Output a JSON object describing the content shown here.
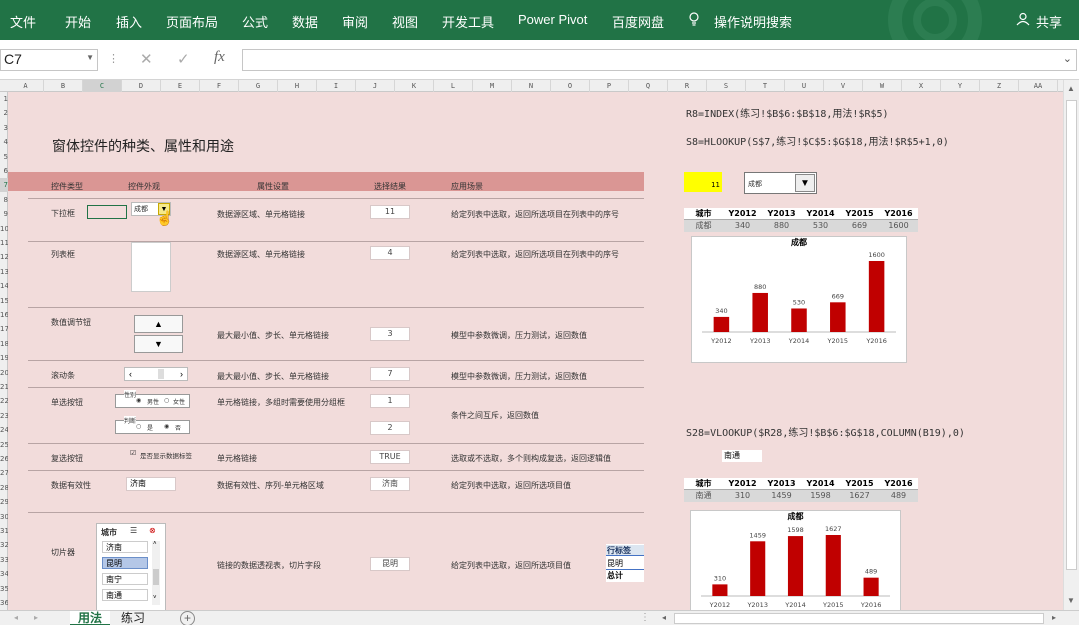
{
  "ribbon": {
    "tabs": [
      "文件",
      "开始",
      "插入",
      "页面布局",
      "公式",
      "数据",
      "审阅",
      "视图",
      "开发工具",
      "Power Pivot",
      "百度网盘"
    ],
    "tell_me": "操作说明搜索",
    "share": "共享"
  },
  "formula_bar": {
    "name_box": "C7",
    "cancel": "✕",
    "enter": "✓",
    "fx": "fx",
    "formula": ""
  },
  "columns": [
    "A",
    "B",
    "C",
    "D",
    "E",
    "F",
    "G",
    "H",
    "I",
    "J",
    "K",
    "L",
    "M",
    "N",
    "O",
    "P",
    "Q",
    "R",
    "S",
    "T",
    "U",
    "V",
    "W",
    "X",
    "Y",
    "Z",
    "AA"
  ],
  "rows": [
    "1",
    "2",
    "3",
    "4",
    "5",
    "6",
    "7",
    "8",
    "9",
    "10",
    "11",
    "12",
    "13",
    "14",
    "15",
    "16",
    "17",
    "18",
    "19",
    "20",
    "21",
    "22",
    "23",
    "24",
    "25",
    "26",
    "27",
    "28",
    "29",
    "30",
    "31",
    "32",
    "33",
    "34",
    "35",
    "36"
  ],
  "sheet": {
    "title": "窗体控件的种类、属性和用途",
    "header": {
      "type": "控件类型",
      "look": "控件外观",
      "attr": "属性设置",
      "result": "选择结果",
      "scene": "应用场景"
    },
    "rows": [
      {
        "type": "下拉框",
        "attr": "数据源区域、单元格链接",
        "result": "11",
        "scene": "给定列表中选取，返回所选项目在列表中的序号"
      },
      {
        "type": "列表框",
        "attr": "数据源区域、单元格链接",
        "result": "4",
        "scene": "给定列表中选取，返回所选项目在列表中的序号"
      },
      {
        "type": "数值调节钮",
        "attr": "最大最小值、步长、单元格链接",
        "result": "3",
        "scene": "模型中参数微调，压力测试，返回数值"
      },
      {
        "type": "滚动条",
        "attr": "最大最小值、步长、单元格链接",
        "result": "7",
        "scene": "模型中参数微调，压力测试，返回数值"
      },
      {
        "type": "单选按钮",
        "attr": "单元格链接，多组时需要使用分组框",
        "result": "1",
        "result2": "2",
        "scene": "条件之间互斥，返回数值"
      },
      {
        "type": "复选按钮",
        "attr": "单元格链接",
        "result": "TRUE",
        "scene": "选取或不选取，多个则构成复选，返回逻辑值"
      },
      {
        "type": "数据有效性",
        "attr": "数据有效性、序列-单元格区域",
        "result": "济南",
        "scene": "给定列表中选取，返回所选项目值"
      },
      {
        "type": "切片器",
        "attr": "链接的数据透视表，切片字段",
        "result": "昆明",
        "scene": "给定列表中选取，返回所选项目值"
      }
    ],
    "dropdown_value": "成都",
    "groupbox1_title": "性别",
    "radio_male": "男性",
    "radio_female": "女性",
    "groupbox2_title": "判断",
    "radio_yes": "是",
    "radio_no": "否",
    "checkbox_label": "是否显示数据标签",
    "validation_value": "济南",
    "slicer": {
      "title": "城市",
      "items": [
        "济南",
        "昆明",
        "南宁",
        "南通"
      ],
      "selected": "昆明"
    },
    "pivot": {
      "header": "行标签",
      "item": "昆明",
      "total": "总计"
    }
  },
  "right": {
    "formula1": "R8=INDEX(练习!$B$6:$B$18,用法!$R$5)",
    "formula2": "S8=HLOOKUP(S$7,练习!$C$5:$G$18,用法!$R$5+1,0)",
    "yellow_value": "11",
    "combo_value": "成都",
    "formula3": "S28=VLOOKUP($R28,练习!$B$6:$G$18,COLUMN(B19),0)",
    "validation_cell": "南通"
  },
  "table1": {
    "headers": [
      "城市",
      "Y2012",
      "Y2013",
      "Y2014",
      "Y2015",
      "Y2016"
    ],
    "row": [
      "成都",
      "340",
      "880",
      "530",
      "669",
      "1600"
    ]
  },
  "table2": {
    "headers": [
      "城市",
      "Y2012",
      "Y2013",
      "Y2014",
      "Y2015",
      "Y2016"
    ],
    "row": [
      "南通",
      "310",
      "1459",
      "1598",
      "1627",
      "489"
    ]
  },
  "chart_data": [
    {
      "type": "bar",
      "title": "成都",
      "categories": [
        "Y2012",
        "Y2013",
        "Y2014",
        "Y2015",
        "Y2016"
      ],
      "values": [
        340,
        880,
        530,
        669,
        1600
      ],
      "color": "#c00000"
    },
    {
      "type": "bar",
      "title": "成都",
      "categories": [
        "Y2012",
        "Y2013",
        "Y2014",
        "Y2015",
        "Y2016"
      ],
      "values": [
        310,
        1459,
        1598,
        1627,
        489
      ],
      "color": "#c00000"
    }
  ],
  "sheet_tabs": [
    "用法",
    "练习"
  ],
  "colors": {
    "ribbon": "#217346",
    "sheet_bg": "#f2dcdb",
    "header_band": "#da9694",
    "bar": "#c00000",
    "yellow": "#ffff00"
  }
}
